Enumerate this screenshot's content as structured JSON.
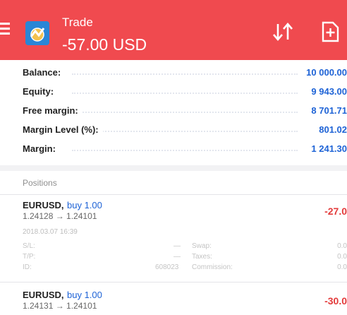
{
  "header": {
    "title": "Trade",
    "amount": "-57.00 USD",
    "background": "#f04a4f"
  },
  "summary": [
    {
      "label": "Balance:",
      "value": "10 000.00"
    },
    {
      "label": "Equity:",
      "value": "9 943.00"
    },
    {
      "label": "Free margin:",
      "value": "8 701.71"
    },
    {
      "label": "Margin Level (%):",
      "value": "801.02"
    },
    {
      "label": "Margin:",
      "value": "1 241.30"
    }
  ],
  "positions_title": "Positions",
  "positions": [
    {
      "symbol": "EURUSD,",
      "side": "buy 1.00",
      "prices": "1.24128 → 1.24101",
      "profit": "-27.0",
      "time": "2018.03.07 16:39",
      "sl_label": "S/L:",
      "sl_value": "—",
      "tp_label": "T/P:",
      "tp_value": "—",
      "id_label": "ID:",
      "id_value": "608023",
      "swap_label": "Swap:",
      "swap_value": "0.0",
      "taxes_label": "Taxes:",
      "taxes_value": "0.0",
      "commission_label": "Commission:",
      "commission_value": "0.0"
    },
    {
      "symbol": "EURUSD,",
      "side": "buy 1.00",
      "prices": "1.24131 → 1.24101",
      "profit": "-30.0"
    }
  ]
}
